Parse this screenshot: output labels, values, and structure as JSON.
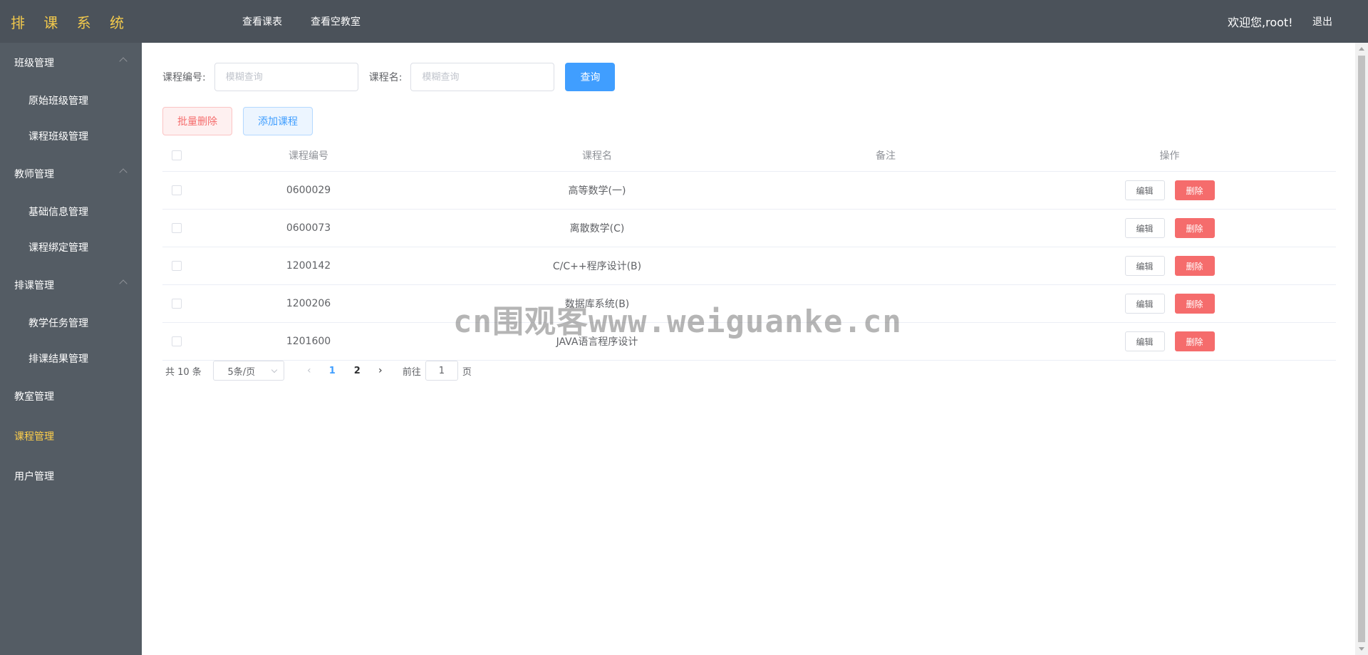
{
  "header": {
    "logo": "排 课 系 统",
    "nav": [
      "查看课表",
      "查看空教室"
    ],
    "welcome": "欢迎您,root!",
    "logout": "退出"
  },
  "sidebar": {
    "groups": [
      {
        "label": "班级管理",
        "expanded": true,
        "items": [
          "原始班级管理",
          "课程班级管理"
        ]
      },
      {
        "label": "教师管理",
        "expanded": true,
        "items": [
          "基础信息管理",
          "课程绑定管理"
        ]
      },
      {
        "label": "排课管理",
        "expanded": true,
        "items": [
          "教学任务管理",
          "排课结果管理"
        ]
      },
      {
        "label": "教室管理",
        "items": []
      },
      {
        "label": "课程管理",
        "active": true,
        "items": []
      },
      {
        "label": "用户管理",
        "items": []
      }
    ],
    "colors": {
      "background": "#545c64",
      "active_text": "#ffd04b"
    }
  },
  "search": {
    "code_label": "课程编号:",
    "code_placeholder": "模糊查询",
    "name_label": "课程名:",
    "name_placeholder": "模糊查询",
    "query_button": "查询"
  },
  "actions": {
    "batch_delete": "批量删除",
    "add_course": "添加课程"
  },
  "table": {
    "headers": [
      "课程编号",
      "课程名",
      "备注",
      "操作"
    ],
    "rows": [
      {
        "code": "0600029",
        "name": "高等数学(一)",
        "note": ""
      },
      {
        "code": "0600073",
        "name": "离散数学(C)",
        "note": ""
      },
      {
        "code": "1200142",
        "name": "C/C++程序设计(B)",
        "note": ""
      },
      {
        "code": "1200206",
        "name": "数据库系统(B)",
        "note": ""
      },
      {
        "code": "1201600",
        "name": "JAVA语言程序设计",
        "note": ""
      }
    ],
    "edit_label": "编辑",
    "delete_label": "删除"
  },
  "pagination": {
    "total": "共 10 条",
    "page_size": "5条/页",
    "pages": [
      "1",
      "2"
    ],
    "current": "1",
    "goto_prefix": "前往",
    "goto_value": "1",
    "goto_suffix": "页"
  },
  "watermark": "cn围观客www.weiguanke.cn",
  "theme": {
    "header_bg": "#4b525a",
    "logo_color": "#f2c94c",
    "primary": "#409eff",
    "danger": "#f56c6c"
  }
}
